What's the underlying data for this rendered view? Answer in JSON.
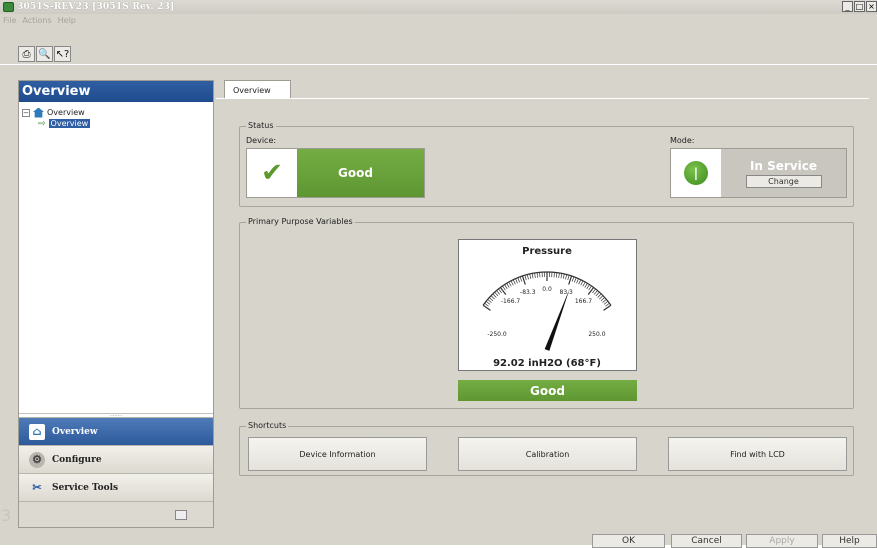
{
  "window": {
    "title": "3051S-REV23 [3051S Rev. 23]",
    "min": "_",
    "max": "□",
    "close": "×"
  },
  "menu": {
    "items": [
      "File",
      "Actions",
      "Help"
    ]
  },
  "toolbar": {
    "print_icon": "printer-icon",
    "preview_icon": "print-preview-icon",
    "help_icon": "context-help-icon"
  },
  "sidebar": {
    "heading": "Overview",
    "tree": {
      "root": "Overview",
      "child": "Overview"
    },
    "grip": "........",
    "nav": [
      {
        "label": "Overview",
        "icon": "home-icon"
      },
      {
        "label": "Configure",
        "icon": "configure-icon"
      },
      {
        "label": "Service Tools",
        "icon": "tools-icon"
      }
    ],
    "edge_char": "3"
  },
  "tabs": {
    "active": "Overview"
  },
  "status": {
    "group_label": "Status",
    "device_label": "Device:",
    "device_value": "Good",
    "mode_label": "Mode:",
    "mode_value": "In Service",
    "change_label": "Change",
    "colors": {
      "good": "#6aa23a"
    }
  },
  "variables": {
    "group_label": "Primary Purpose Variables",
    "gauge": {
      "title": "Pressure",
      "ticks": [
        "-250.0",
        "-166.7",
        "-83.3",
        "0.0",
        "83.3",
        "166.7",
        "250.0"
      ],
      "min": -250.0,
      "max": 250.0,
      "value": 92.02,
      "reading": "92.02 inH2O (68°F)"
    },
    "status_value": "Good"
  },
  "shortcuts": {
    "group_label": "Shortcuts",
    "buttons": [
      "Device Information",
      "Calibration",
      "Find with LCD"
    ]
  },
  "dialog": {
    "ok": "OK",
    "cancel": "Cancel",
    "apply": "Apply",
    "help": "Help"
  }
}
